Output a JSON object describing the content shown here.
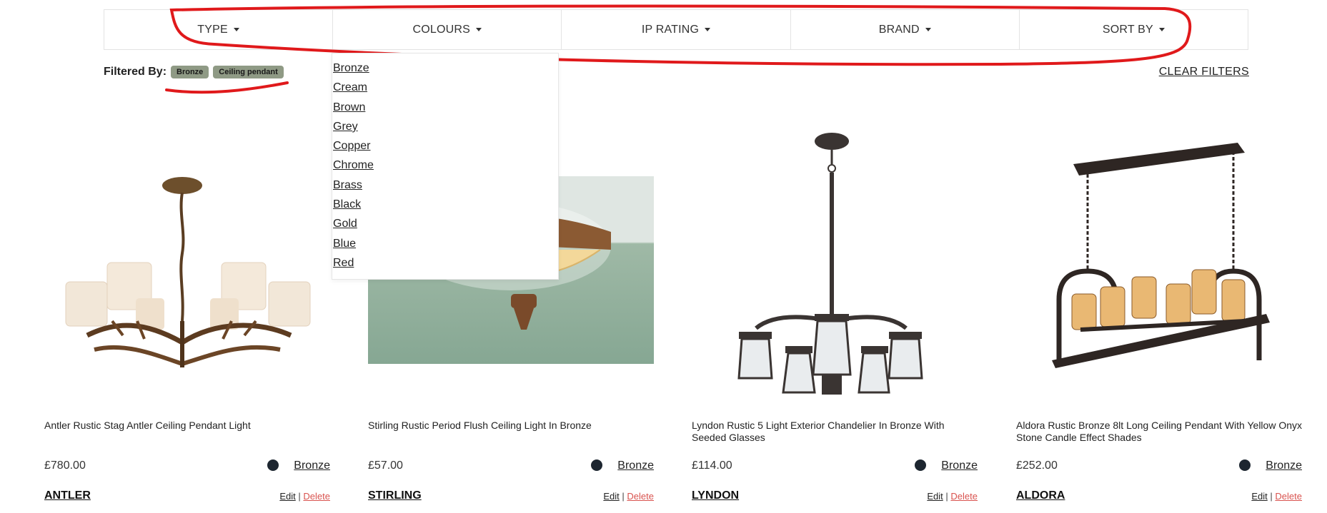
{
  "filters": {
    "tabs": [
      {
        "label": "TYPE"
      },
      {
        "label": "COLOURS"
      },
      {
        "label": "IP RATING"
      },
      {
        "label": "BRAND"
      },
      {
        "label": "SORT BY"
      }
    ]
  },
  "filtered_by": {
    "label": "Filtered By:",
    "chips": [
      "Bronze",
      "Ceiling pendant"
    ],
    "clear_label": "CLEAR FILTERS"
  },
  "colour_dropdown": {
    "options": [
      "Bronze",
      "Cream",
      "Brown",
      "Grey",
      "Copper",
      "Chrome",
      "Brass",
      "Black",
      "Gold",
      "Blue",
      "Red"
    ]
  },
  "products": [
    {
      "title": "Antler Rustic Stag Antler Ceiling Pendant Light",
      "price": "£780.00",
      "colour": "Bronze",
      "brand": "ANTLER",
      "edit": "Edit",
      "delete": "Delete"
    },
    {
      "title": "Stirling Rustic Period Flush Ceiling Light In Bronze",
      "price": "£57.00",
      "colour": "Bronze",
      "brand": "STIRLING",
      "edit": "Edit",
      "delete": "Delete"
    },
    {
      "title": "Lyndon Rustic 5 Light Exterior Chandelier In Bronze With Seeded Glasses",
      "price": "£114.00",
      "colour": "Bronze",
      "brand": "LYNDON",
      "edit": "Edit",
      "delete": "Delete"
    },
    {
      "title": "Aldora Rustic Bronze 8lt Long Ceiling Pendant With Yellow Onyx Stone Candle Effect Shades",
      "price": "£252.00",
      "colour": "Bronze",
      "brand": "ALDORA",
      "edit": "Edit",
      "delete": "Delete"
    }
  ],
  "action_separator": "|",
  "colors": {
    "chip_bg": "#8f9a85",
    "delete_red": "#d9534f",
    "swatch": "#1d2630",
    "annotation_red": "#e0191b"
  }
}
